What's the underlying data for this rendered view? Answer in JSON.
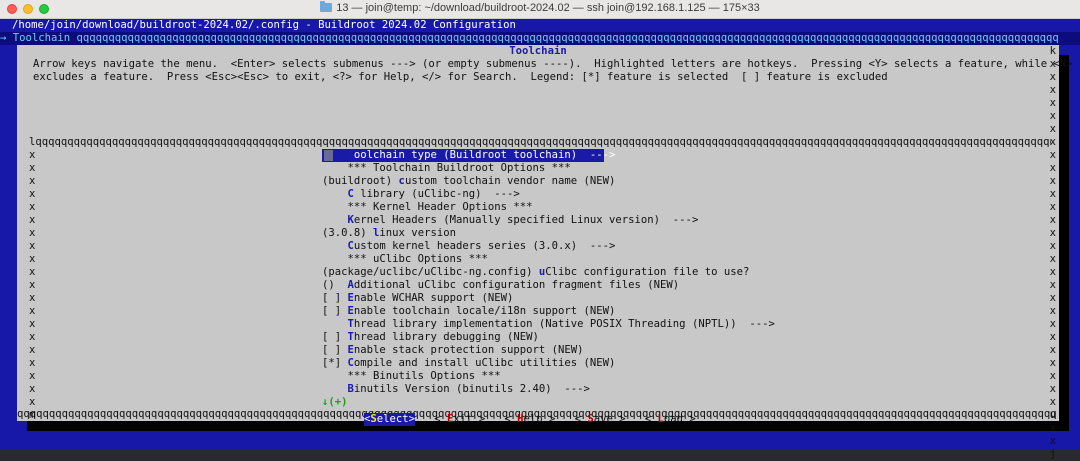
{
  "window": {
    "title": "13 — join@temp: ~/download/buildroot-2024.02 — ssh join@192.168.1.125 — 175×33"
  },
  "terminal": {
    "path_line": "/home/join/download/buildroot-2024.02/.config - Buildroot 2024.02 Configuration",
    "breadcrumb": "→ Toolchain qqqqqqqqqqqqqqqqqqqqqqqqqqqqqqqqqqqqqqqqqqqqqqqqqqqqqqqqqqqqqqqqqqqqqqqqqqqqqqqqqqqqqqqqqqqqqqqqqqqqqqqqqqqqqqqqqqqqqqqqqqqqqqqqqqqqqqqqqqqqqqqqqqqqqqqqqq"
  },
  "dialog": {
    "title": "Toolchain",
    "help_line1": "Arrow keys navigate the menu.  <Enter> selects submenus ---> (or empty submenus ----).  Highlighted letters are hotkeys.  Pressing <Y> selects a feature, while <N>",
    "help_line2": "excludes a feature.  Press <Esc><Esc> to exit, <?> for Help, </> for Search.  Legend: [*] feature is selected  [ ] feature is excluded",
    "box_top": "lqqqqqqqqqqqqqqqqqqqqqqqqqqqqqqqqqqqqqqqqqqqqqqqqqqqqqqqqqqqqqqqqqqqqqqqqqqqqqqqqqqqqqqqqqqqqqqqqqqqqqqqqqqqqqqqqqqqqqqqqqqqqqqqqqqqqqqqqqqqqqqqqqqqqqqqqqqqqqqqqqqq",
    "box_bottom": "qqqqqqqqqqqqqqqqqqqqqqqqqqqqqqqqqqqqqqqqqqqqqqqqqqqqqqqqqqqqqqqqqqqqqqqqqqqqqqqqqqqqqqqqqqqqqqqqqqqqqqqqqqqqqqqqqqqqqqqqqqqqqqqqqqqqqqqqqqqqqqqqqqqqqqqqqqqqqqqqqqqqqqqqqj",
    "left_border": "x\nx\nx\nx\nx\nx\nx\nx\nx\nx\nx\nx\nx\nx\nx\nx\nx\nx\nx\nx\nm",
    "right_border": "k\nx\nx\nx\nx\nx\nx\nx\nx\nx\nx\nx\nx\nx\nx\nx\nx\nx\nx\nx\nx\nx\nx\nx\nx\nx\nx\nx\nu\nx\nx\nj",
    "more_indicator": "↓(+)"
  },
  "menu_items": [
    {
      "pre": "    ",
      "hk": "T",
      "post": "oolchain type (Buildroot toolchain)  --->"
    },
    {
      "pre": "    *** Toolchain Buildroot Options ***",
      "hk": "",
      "post": ""
    },
    {
      "pre": "(buildroot) ",
      "hk": "c",
      "post": "ustom toolchain vendor name (NEW)"
    },
    {
      "pre": "    ",
      "hk": "C",
      "post": " library (uClibc-ng)  --->"
    },
    {
      "pre": "    *** Kernel Header Options ***",
      "hk": "",
      "post": ""
    },
    {
      "pre": "    ",
      "hk": "K",
      "post": "ernel Headers (Manually specified Linux version)  --->"
    },
    {
      "pre": "(3.0.8) ",
      "hk": "l",
      "post": "inux version"
    },
    {
      "pre": "    ",
      "hk": "C",
      "post": "ustom kernel headers series (3.0.x)  --->"
    },
    {
      "pre": "    *** uClibc Options ***",
      "hk": "",
      "post": ""
    },
    {
      "pre": "(package/uclibc/uClibc-ng.config) ",
      "hk": "u",
      "post": "Clibc configuration file to use?"
    },
    {
      "pre": "()  ",
      "hk": "A",
      "post": "dditional uClibc configuration fragment files (NEW)"
    },
    {
      "pre": "[ ] ",
      "hk": "E",
      "post": "nable WCHAR support (NEW)"
    },
    {
      "pre": "[ ] ",
      "hk": "E",
      "post": "nable toolchain locale/i18n support (NEW)"
    },
    {
      "pre": "    ",
      "hk": "T",
      "post": "hread library implementation (Native POSIX Threading (NPTL))  --->"
    },
    {
      "pre": "[ ] ",
      "hk": "T",
      "post": "hread library debugging (NEW)"
    },
    {
      "pre": "[ ] ",
      "hk": "E",
      "post": "nable stack protection support (NEW)"
    },
    {
      "pre": "[*] ",
      "hk": "C",
      "post": "ompile and install uClibc utilities (NEW)"
    },
    {
      "pre": "    *** Binutils Options ***",
      "hk": "",
      "post": ""
    },
    {
      "pre": "    ",
      "hk": "B",
      "post": "inutils Version (binutils 2.40)  --->"
    }
  ],
  "buttons": [
    {
      "pre": "<",
      "hk": "S",
      "post": "elect>",
      "active": true
    },
    {
      "pre": "< ",
      "hk": "E",
      "post": "xit >",
      "active": false
    },
    {
      "pre": "< ",
      "hk": "H",
      "post": "elp >",
      "active": false
    },
    {
      "pre": "< ",
      "hk": "S",
      "post": "ave >",
      "active": false
    },
    {
      "pre": "< ",
      "hk": "L",
      "post": "oad >",
      "active": false
    }
  ]
}
